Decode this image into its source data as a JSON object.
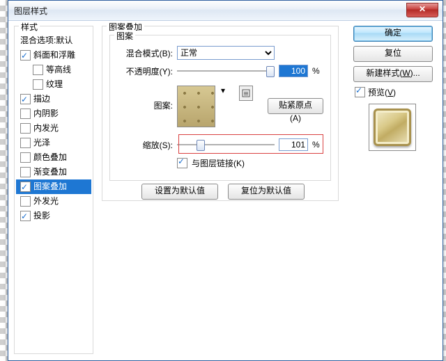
{
  "dialog": {
    "title": "图层样式",
    "close_glyph": "✕"
  },
  "styles": {
    "legend": "样式",
    "items": [
      {
        "label": "混合选项:默认",
        "type": "header"
      },
      {
        "label": "斜面和浮雕",
        "checked": true
      },
      {
        "label": "等高线",
        "checked": false,
        "indent": true
      },
      {
        "label": "纹理",
        "checked": false,
        "indent": true
      },
      {
        "label": "描边",
        "checked": true
      },
      {
        "label": "内阴影",
        "checked": false
      },
      {
        "label": "内发光",
        "checked": false
      },
      {
        "label": "光泽",
        "checked": false
      },
      {
        "label": "颜色叠加",
        "checked": false
      },
      {
        "label": "渐变叠加",
        "checked": false
      },
      {
        "label": "图案叠加",
        "checked": true,
        "selected": true
      },
      {
        "label": "外发光",
        "checked": false
      },
      {
        "label": "投影",
        "checked": true
      }
    ]
  },
  "center": {
    "group_title": "图案叠加",
    "pattern_group": "图案",
    "blend_mode_label": "混合模式(B):",
    "blend_mode_value": "正常",
    "opacity_label": "不透明度(Y):",
    "opacity_value": "100",
    "pct": "%",
    "pattern_label": "图案:",
    "snap_button": "贴紧原点(A)",
    "scale_label": "缩放(S):",
    "scale_value": "101",
    "link_label": "与图层链接(K)",
    "make_default": "设置为默认值",
    "reset_default": "复位为默认值"
  },
  "right": {
    "ok": "确定",
    "cancel": "复位",
    "new_style_pre": "新建样式(",
    "new_style_u": "W",
    "new_style_post": ")...",
    "preview_pre": "预览(",
    "preview_u": "V",
    "preview_post": ")"
  }
}
